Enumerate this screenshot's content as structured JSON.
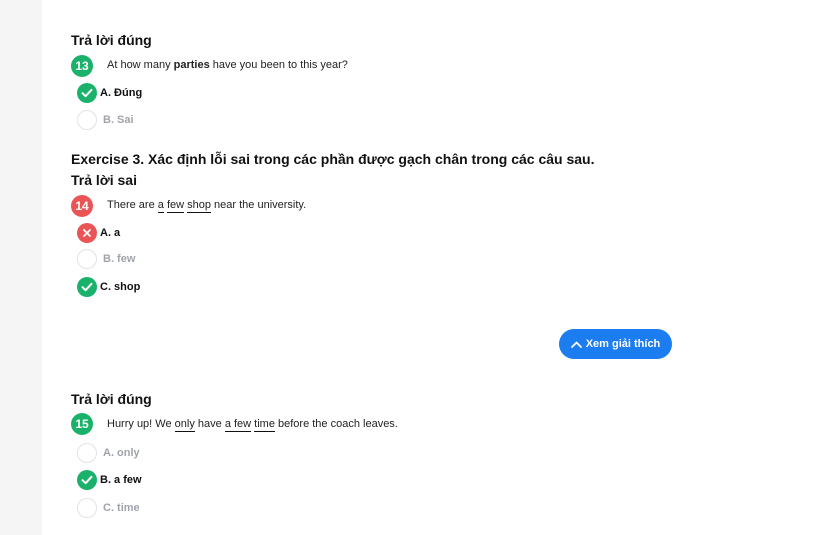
{
  "q13": {
    "status": "Trả lời đúng",
    "number": "13",
    "text_before": "At how many ",
    "text_bold": "parties",
    "text_after": " have you been to this year?",
    "options": [
      {
        "label": "A. Đúng",
        "state": "correct"
      },
      {
        "label": "B. Sai",
        "state": "unselected"
      }
    ]
  },
  "exercise3": {
    "title": "Exercise 3. Xác định lỗi sai trong các phần được gạch chân trong các câu sau."
  },
  "q14": {
    "status": "Trả lời sai",
    "number": "14",
    "text_1": "There are ",
    "u1": "a",
    "text_2": " ",
    "u2": "few",
    "text_3": " ",
    "u3": "shop",
    "text_4": " near the university.",
    "options": [
      {
        "label": "A. a",
        "state": "wrong"
      },
      {
        "label": "B. few",
        "state": "unselected"
      },
      {
        "label": "C. shop",
        "state": "correct"
      }
    ]
  },
  "explain_button": {
    "label": "Xem giải thích",
    "icon": "chevron-up-icon"
  },
  "q15": {
    "status": "Trả lời đúng",
    "number": "15",
    "text_1": "Hurry up! We ",
    "u1": "only",
    "text_2": " have ",
    "u2": "a few",
    "text_3": " ",
    "u3": "time",
    "text_4": " before the coach leaves.",
    "options": [
      {
        "label": "A. only",
        "state": "unselected"
      },
      {
        "label": "B. a few",
        "state": "correct"
      },
      {
        "label": "C. time",
        "state": "unselected"
      }
    ]
  },
  "colors": {
    "correct": "#1ab26b",
    "wrong": "#ea5455",
    "accent": "#1c7df0",
    "muted": "#a0a3ab"
  }
}
